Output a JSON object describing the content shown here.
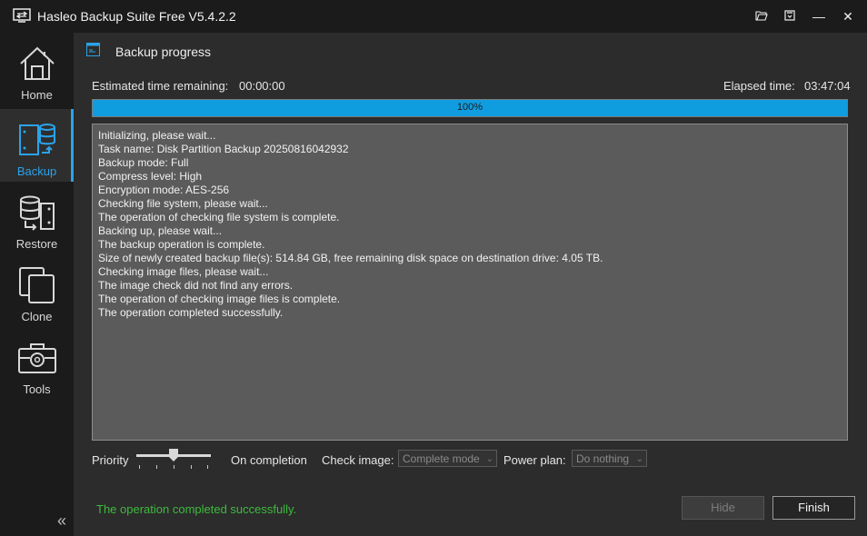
{
  "window": {
    "title": "Hasleo Backup Suite Free V5.4.2.2",
    "icons": [
      "app-logo-icon",
      "folder-open-icon",
      "menu-box-icon",
      "minimize-icon",
      "close-icon"
    ],
    "minimize_glyph": "—",
    "close_glyph": "✕"
  },
  "sidebar": {
    "items": [
      {
        "label": "Home",
        "icon": "home-icon",
        "active": false
      },
      {
        "label": "Backup",
        "icon": "backup-icon",
        "active": true
      },
      {
        "label": "Restore",
        "icon": "restore-icon",
        "active": false
      },
      {
        "label": "Clone",
        "icon": "clone-icon",
        "active": false
      },
      {
        "label": "Tools",
        "icon": "tools-icon",
        "active": false
      }
    ],
    "collapse_glyph": "«"
  },
  "panel": {
    "title": "Backup progress",
    "estimated_label": "Estimated time remaining:",
    "estimated_value": "00:00:00",
    "elapsed_label": "Elapsed time:",
    "elapsed_value": "03:47:04",
    "progress_percent": 100,
    "progress_text": "100%"
  },
  "log": [
    "Initializing, please wait...",
    "Task name: Disk Partition Backup 20250816042932",
    "Backup mode: Full",
    "Compress level: High",
    "Encryption mode: AES-256",
    "Checking file system, please wait...",
    "The operation of checking file system is complete.",
    "Backing up, please wait...",
    "The backup operation is complete.",
    "Size of newly created backup file(s): 514.84 GB, free remaining disk space on destination drive: 4.05 TB.",
    "Checking image files, please wait...",
    "The image check did not find any errors.",
    "The operation of checking image files is complete.",
    "The operation completed successfully."
  ],
  "options": {
    "priority_label": "Priority",
    "on_completion_label": "On completion",
    "check_image_label": "Check image:",
    "check_image_value": "Complete mode",
    "power_plan_label": "Power plan:",
    "power_plan_value": "Do nothing"
  },
  "footer": {
    "status": "The operation completed successfully.",
    "hide_label": "Hide",
    "finish_label": "Finish"
  },
  "colors": {
    "accent": "#2ba3ea",
    "progress": "#109de0",
    "success": "#3dbb3d"
  }
}
